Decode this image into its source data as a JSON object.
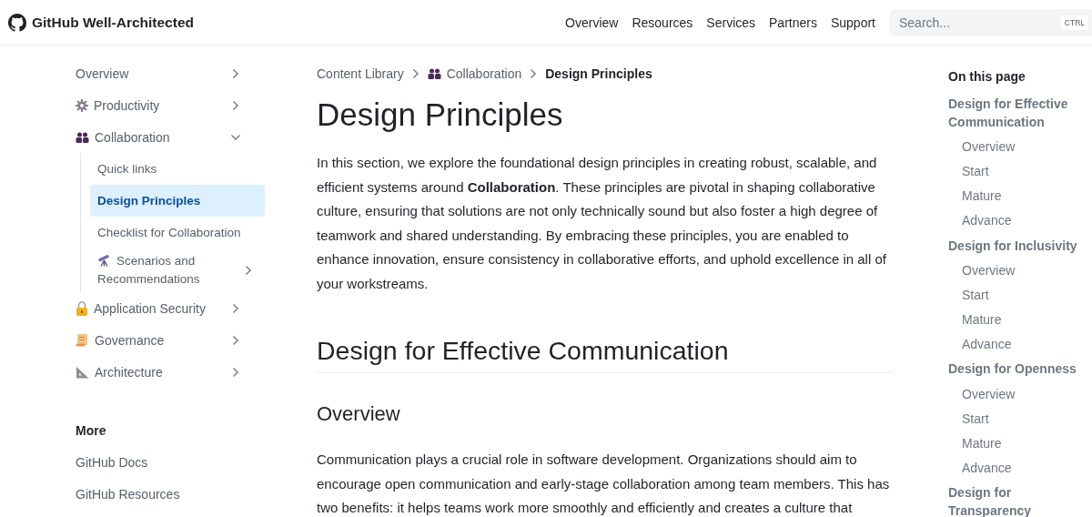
{
  "header": {
    "title": "GitHub Well-Architected",
    "nav": [
      {
        "label": "Overview"
      },
      {
        "label": "Resources"
      },
      {
        "label": "Services"
      },
      {
        "label": "Partners"
      },
      {
        "label": "Support"
      }
    ],
    "search": {
      "placeholder": "Search...",
      "shortcut": "CTRL"
    }
  },
  "sidebar": {
    "items": [
      {
        "label": "Overview",
        "kind": "plain",
        "expanded": false,
        "selected": false
      },
      {
        "label": "Productivity",
        "kind": "gear",
        "expanded": false,
        "selected": false
      },
      {
        "label": "Collaboration",
        "kind": "people",
        "expanded": true,
        "selected": false,
        "children": [
          {
            "label": "Quick links",
            "kind": "leaf",
            "selected": false
          },
          {
            "label": "Design Principles",
            "kind": "leaf",
            "selected": true
          },
          {
            "label": "Checklist for Collaboration",
            "kind": "leaf",
            "selected": false
          },
          {
            "label": "Scenarios and Recommendations",
            "kind": "telescope",
            "expanded": false,
            "selected": false
          }
        ]
      },
      {
        "label": "Application Security",
        "kind": "lock",
        "expanded": false,
        "selected": false
      },
      {
        "label": "Governance",
        "kind": "scroll",
        "expanded": false,
        "selected": false
      },
      {
        "label": "Architecture",
        "kind": "ruler",
        "expanded": false,
        "selected": false
      }
    ],
    "more": {
      "heading": "More",
      "links": [
        {
          "label": "GitHub Docs"
        },
        {
          "label": "GitHub Resources"
        }
      ]
    }
  },
  "breadcrumb": [
    {
      "label": "Content Library",
      "kind": "link"
    },
    {
      "label": "Collaboration",
      "kind": "people"
    },
    {
      "label": "Design Principles",
      "kind": "current"
    }
  ],
  "content": [
    {
      "kind": "h1",
      "text": "Design Principles"
    },
    {
      "kind": "p",
      "text": "In this section, we explore the foundational design principles in creating robust, scalable, and efficient systems around **Collaboration**. These principles are pivotal in shaping collaborative culture, ensuring that solutions are not only technically sound but also foster a high degree of teamwork and shared understanding. By embracing these principles, you are enabled to enhance innovation, ensure consistency in collaborative efforts, and uphold excellence in all of your workstreams."
    },
    {
      "kind": "h2",
      "text": "Design for Effective Communication"
    },
    {
      "kind": "h3",
      "text": "Overview"
    },
    {
      "kind": "p",
      "text": "Communication plays a crucial role in software development. Organizations should aim to encourage open communication and early-stage collaboration among team members. This has two benefits: it helps teams work more smoothly and efficiently and creates a culture that"
    }
  ],
  "toc": {
    "heading": "On this page",
    "sections": [
      {
        "label": "Design for Effective Communication",
        "children": [
          {
            "label": "Overview"
          },
          {
            "label": "Start"
          },
          {
            "label": "Mature"
          },
          {
            "label": "Advance"
          }
        ]
      },
      {
        "label": "Design for Inclusivity",
        "children": [
          {
            "label": "Overview"
          },
          {
            "label": "Start"
          },
          {
            "label": "Mature"
          },
          {
            "label": "Advance"
          }
        ]
      },
      {
        "label": "Design for Openness",
        "children": [
          {
            "label": "Overview"
          },
          {
            "label": "Start"
          },
          {
            "label": "Mature"
          },
          {
            "label": "Advance"
          }
        ]
      },
      {
        "label": "Design for Transparency"
      }
    ]
  }
}
